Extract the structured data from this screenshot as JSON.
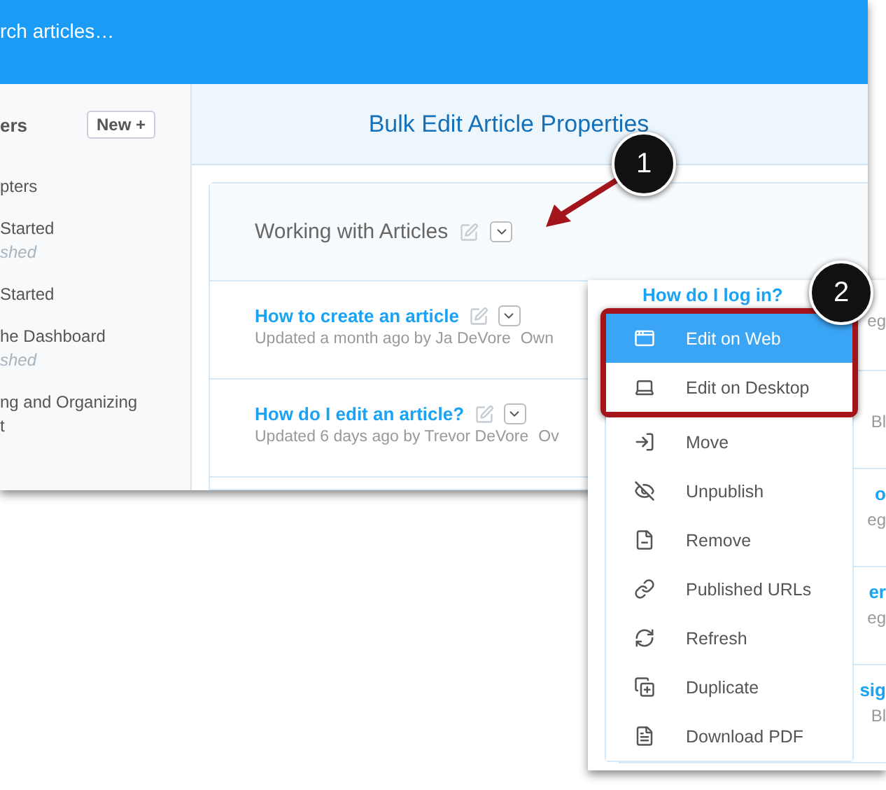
{
  "search": {
    "placeholder": "rch articles…"
  },
  "sidebar": {
    "heading": "ers",
    "new_button": "New +",
    "items": [
      {
        "title": "pters"
      },
      {
        "title": "Started",
        "status": "shed"
      },
      {
        "title": "Started"
      },
      {
        "title": "he Dashboard",
        "status": "shed"
      },
      {
        "title": "ng and Organizing",
        "subtitle": "t"
      }
    ]
  },
  "page_title": "Bulk Edit Article Properties",
  "section": {
    "title": "Working with Articles",
    "articles": [
      {
        "title": "How to create an article",
        "meta": "Updated a month ago by Ja DeVore",
        "owner": "Own"
      },
      {
        "title": "How do I edit an article?",
        "meta": "Updated 6 days ago by Trevor DeVore",
        "owner": "Ov"
      }
    ]
  },
  "background_rows": [
    {
      "title": "How do I log in?",
      "meta": "eg"
    },
    {
      "meta": "Bl"
    },
    {
      "title": "o",
      "meta": "eg"
    },
    {
      "title": "er",
      "meta": "eg"
    },
    {
      "title": "sig",
      "meta": "Bl"
    }
  ],
  "menu": [
    {
      "label": "Edit on Web",
      "selected": true
    },
    {
      "label": "Edit on Desktop",
      "selected": false
    },
    {
      "label": "Move",
      "selected": false
    },
    {
      "label": "Unpublish",
      "selected": false
    },
    {
      "label": "Remove",
      "selected": false
    },
    {
      "label": "Published URLs",
      "selected": false
    },
    {
      "label": "Refresh",
      "selected": false
    },
    {
      "label": "Duplicate",
      "selected": false
    },
    {
      "label": "Download PDF",
      "selected": false
    }
  ],
  "callouts": [
    "1",
    "2"
  ]
}
